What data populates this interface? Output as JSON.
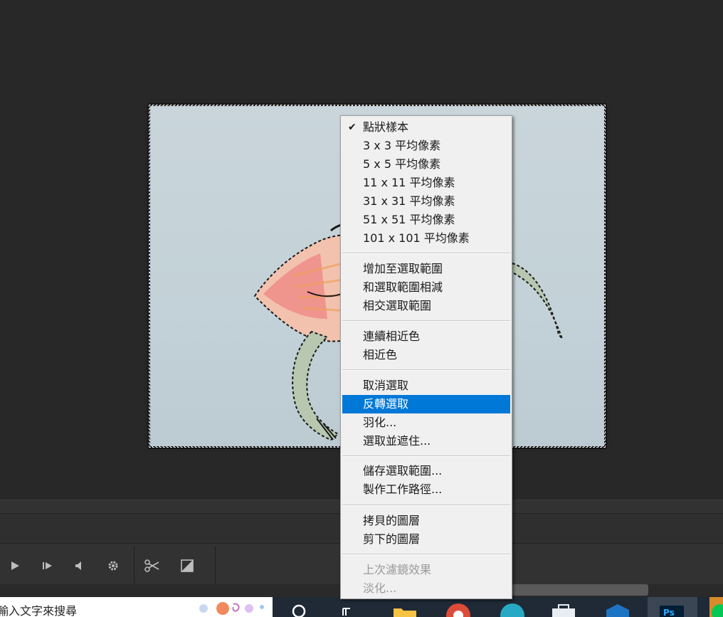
{
  "sample_menu": {
    "items": [
      {
        "label": "點狀樣本",
        "checked": true
      },
      {
        "label": "3 x 3 平均像素"
      },
      {
        "label": "5 x 5 平均像素"
      },
      {
        "label": "11 x 11 平均像素"
      },
      {
        "label": "31 x 31 平均像素"
      },
      {
        "label": "51 x 51 平均像素"
      },
      {
        "label": "101 x 101 平均像素"
      }
    ]
  },
  "selection_mode_menu": {
    "items": [
      {
        "label": "增加至選取範圍"
      },
      {
        "label": "和選取範圍相減"
      },
      {
        "label": "相交選取範圍"
      }
    ]
  },
  "color_menu": {
    "items": [
      {
        "label": "連續相近色"
      },
      {
        "label": "相近色"
      }
    ]
  },
  "select_menu": {
    "items": [
      {
        "label": "取消選取"
      },
      {
        "label": "反轉選取",
        "highlighted": true
      },
      {
        "label": "羽化..."
      },
      {
        "label": "選取並遮住..."
      }
    ]
  },
  "save_menu": {
    "items": [
      {
        "label": "儲存選取範圍..."
      },
      {
        "label": "製作工作路徑..."
      }
    ]
  },
  "layer_menu": {
    "items": [
      {
        "label": "拷貝的圖層"
      },
      {
        "label": "剪下的圖層"
      }
    ]
  },
  "filter_menu": {
    "items": [
      {
        "label": "上次濾鏡效果",
        "disabled": true
      },
      {
        "label": "淡化...",
        "disabled": true
      }
    ]
  },
  "taskbar": {
    "search_text": "輸入文字來搜尋"
  },
  "icons": {
    "checkmark": "checkmark-icon",
    "play": "play-icon",
    "next_frame": "next-frame-icon",
    "audio": "audio-icon",
    "settings": "gear-icon",
    "split": "scissors-icon",
    "transition": "transition-icon"
  },
  "colors": {
    "menu_bg": "#f0f0f0",
    "highlight": "#0078d7",
    "disabled_text": "#9a9a9a",
    "canvas_bg": "#282828"
  }
}
